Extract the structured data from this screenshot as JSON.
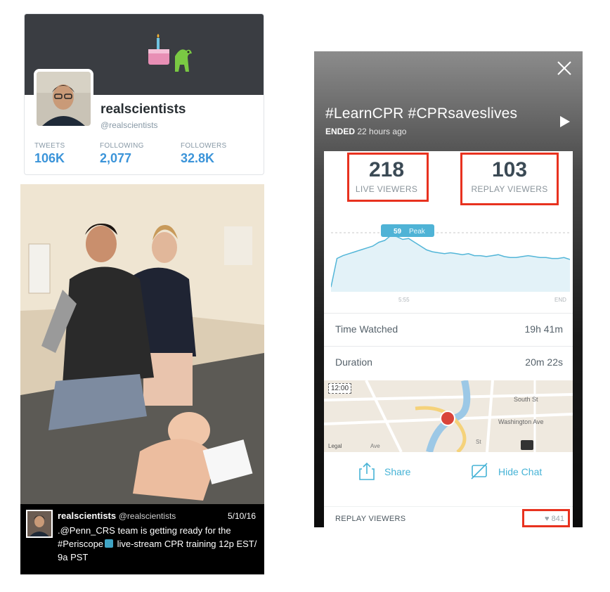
{
  "twitter": {
    "name": "realscientists",
    "handle": "@realscientists",
    "stats": [
      {
        "label": "TWEETS",
        "value": "106K"
      },
      {
        "label": "FOLLOWING",
        "value": "2,077"
      },
      {
        "label": "FOLLOWERS",
        "value": "32.8K"
      }
    ]
  },
  "tweet": {
    "name": "realscientists",
    "handle": "@realscientists",
    "date": "5/10/16",
    "text_before": ".@Penn_CRS team is getting ready for the #Periscope",
    "text_after": " live-stream CPR training 12p EST/ 9a PST"
  },
  "periscope": {
    "title": "#LearnCPR #CPRsaveslives",
    "status_strong": "ENDED",
    "status_time": "22 hours ago",
    "live_viewers": {
      "count": "218",
      "label": "LIVE VIEWERS"
    },
    "replay_viewers": {
      "count": "103",
      "label": "REPLAY VIEWERS"
    },
    "peak": {
      "count": "59",
      "label": "Peak"
    },
    "chart_ticks": {
      "mid": "5:55",
      "end": "END"
    },
    "rows": [
      {
        "label": "Time Watched",
        "value": "19h 41m"
      },
      {
        "label": "Duration",
        "value": "20m 22s"
      }
    ],
    "map": {
      "time": "12:00",
      "labels": {
        "south": "South St",
        "washington": "Washington Ave",
        "legal": "Legal",
        "st": "St",
        "ave": "Ave"
      }
    },
    "share_label": "Share",
    "hide_chat_label": "Hide Chat",
    "replay_section_label": "REPLAY VIEWERS",
    "likes": "841",
    "colors": {
      "accent": "#46b3d6",
      "highlight": "#e8321f"
    }
  },
  "chart_data": {
    "type": "area",
    "x": [
      0,
      1,
      2,
      3,
      4,
      5,
      6,
      7,
      8,
      9,
      10,
      11,
      12,
      13,
      14,
      15,
      16,
      17,
      18,
      19,
      20,
      21,
      22,
      23,
      24,
      25,
      26,
      27,
      28,
      29,
      30,
      31,
      32,
      33,
      34,
      35,
      36,
      37,
      38,
      39,
      40
    ],
    "values": [
      5,
      35,
      38,
      40,
      42,
      44,
      46,
      48,
      52,
      54,
      59,
      58,
      55,
      56,
      52,
      48,
      44,
      42,
      41,
      40,
      41,
      40,
      39,
      40,
      38,
      38,
      37,
      38,
      39,
      37,
      36,
      36,
      37,
      38,
      37,
      36,
      36,
      35,
      35,
      36,
      34
    ],
    "peak_label": "59 Peak",
    "tick_labels": [
      "5:55",
      "END"
    ],
    "ylim": [
      0,
      65
    ]
  }
}
